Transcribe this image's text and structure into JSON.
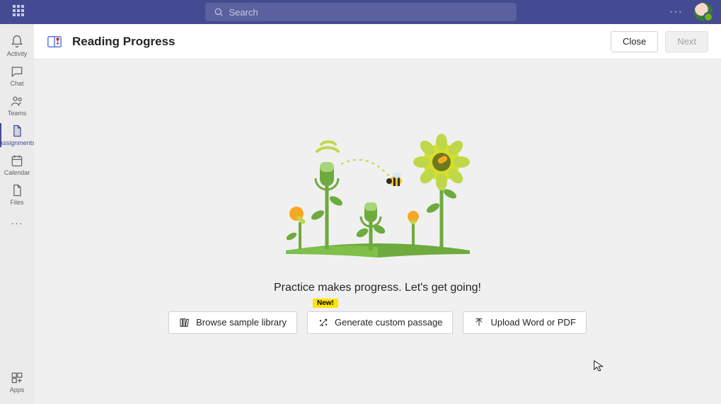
{
  "titlebar": {
    "search_placeholder": "Search",
    "ellipsis": "···"
  },
  "rail": {
    "items": [
      {
        "id": "activity",
        "label": "Activity"
      },
      {
        "id": "chat",
        "label": "Chat"
      },
      {
        "id": "teams",
        "label": "Teams"
      },
      {
        "id": "assignments",
        "label": "Assignments"
      },
      {
        "id": "calendar",
        "label": "Calendar"
      },
      {
        "id": "files",
        "label": "Files"
      }
    ],
    "more": "···",
    "apps": {
      "label": "Apps"
    }
  },
  "header": {
    "title": "Reading Progress",
    "close_label": "Close",
    "next_label": "Next"
  },
  "main": {
    "tagline": "Practice makes progress. Let's get going!",
    "badge_new": "New!",
    "options": {
      "browse": "Browse sample library",
      "generate": "Generate custom passage",
      "upload": "Upload Word or PDF"
    }
  }
}
